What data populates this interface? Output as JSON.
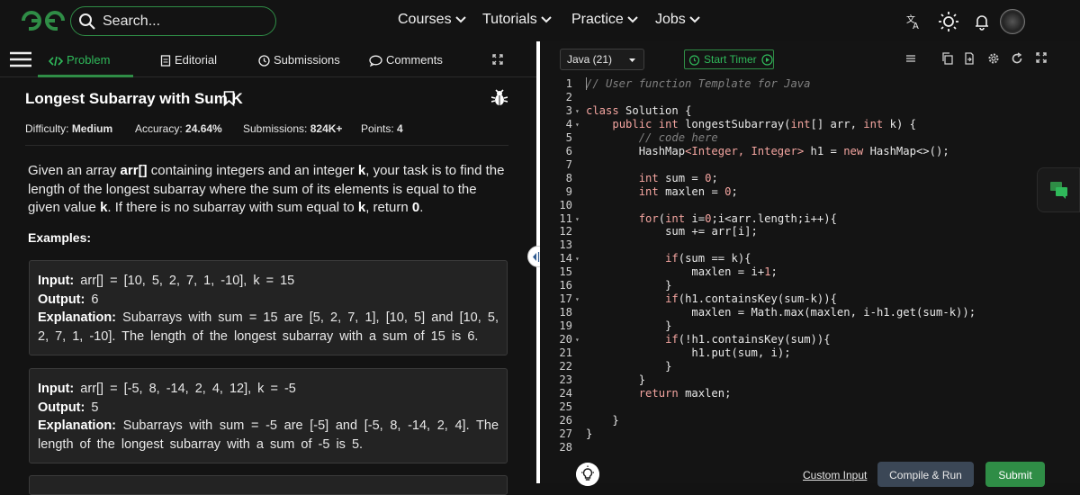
{
  "colors": {
    "brand": "#2f8d46",
    "accent": "#2fb95a",
    "bg": "#131313",
    "compile_bg": "#3b4756",
    "syntax_keyword": "#f4a5a0",
    "comment": "#808080"
  },
  "header": {
    "search_placeholder": "Search...",
    "nav": [
      "Courses",
      "Tutorials",
      "Practice",
      "Jobs"
    ],
    "icons": [
      "translate-icon",
      "theme-toggle-icon",
      "bell-icon",
      "avatar"
    ]
  },
  "tabs": [
    {
      "label": "Problem",
      "icon": "code-icon",
      "active": true
    },
    {
      "label": "Editorial",
      "icon": "document-icon"
    },
    {
      "label": "Submissions",
      "icon": "clock-icon"
    },
    {
      "label": "Comments",
      "icon": "comment-icon"
    }
  ],
  "problem": {
    "title": "Longest Subarray with Sum K",
    "difficulty_label": "Difficulty:",
    "difficulty": "Medium",
    "accuracy_label": "Accuracy:",
    "accuracy": "24.64%",
    "submissions_label": "Submissions:",
    "submissions": "824K+",
    "points_label": "Points:",
    "points": "4",
    "desc_parts": [
      "Given an array ",
      "arr[]",
      " containing integers and an integer ",
      "k",
      ", your task is to find the length of the longest subarray where the sum of its elements is equal to the given value ",
      "k",
      ". If there is no subarray with sum equal to ",
      "k",
      ", return ",
      "0",
      "."
    ],
    "examples_heading": "Examples:",
    "examples": [
      {
        "input_label": "Input:",
        "input": "arr[] = [10, 5, 2, 7, 1, -10], k = 15",
        "output_label": "Output:",
        "output": "6",
        "explanation_label": "Explanation:",
        "explanation": "Subarrays with sum = 15 are [5, 2, 7, 1], [10, 5] and [10, 5, 2, 7, 1, -10]. The length of the longest subarray with a sum of 15 is 6."
      },
      {
        "input_label": "Input:",
        "input": "arr[] = [-5, 8, -14, 2, 4, 12], k = -5",
        "output_label": "Output:",
        "output": "5",
        "explanation_label": "Explanation:",
        "explanation": "Subarrays with sum = -5 are [-5] and [-5, 8, -14, 2, 4]. The length of the longest subarray with a sum of -5 is 5."
      }
    ]
  },
  "editor": {
    "language": "Java (21)",
    "timer_label": "Start Timer",
    "lines": [
      "// User function Template for Java",
      "",
      "class Solution {",
      "    public int longestSubarray(int[] arr, int k) {",
      "        // code here",
      "        HashMap<Integer, Integer> h1 = new HashMap<>();",
      "",
      "        int sum = 0;",
      "        int maxlen = 0;",
      "",
      "        for(int i=0;i<arr.length;i++){",
      "            sum += arr[i];",
      "",
      "            if(sum == k){",
      "                maxlen = i+1;",
      "            }",
      "            if(h1.containsKey(sum-k)){",
      "                maxlen = Math.max(maxlen, i-h1.get(sum-k));",
      "            }",
      "            if(!h1.containsKey(sum)){",
      "                h1.put(sum, i);",
      "            }",
      "        }",
      "        return maxlen;",
      "",
      "    }",
      "}",
      ""
    ],
    "fold_lines": [
      3,
      4,
      11,
      14,
      17,
      20
    ]
  },
  "footer": {
    "custom_input": "Custom Input",
    "compile_run": "Compile & Run",
    "submit": "Submit"
  }
}
